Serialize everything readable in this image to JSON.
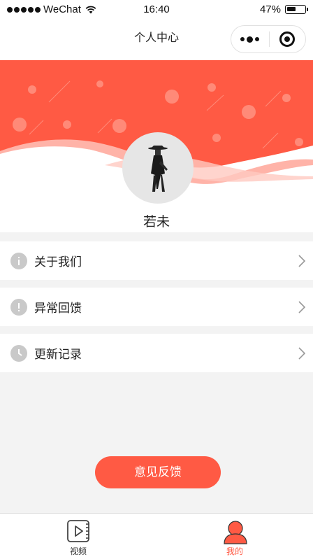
{
  "status_bar": {
    "carrier": "WeChat",
    "time": "16:40",
    "battery": "47%"
  },
  "nav": {
    "title": "个人中心"
  },
  "profile": {
    "name": "若未"
  },
  "menu": [
    {
      "label": "关于我们",
      "icon": "info-icon"
    },
    {
      "label": "异常回馈",
      "icon": "exclamation-icon"
    },
    {
      "label": "更新记录",
      "icon": "clock-icon"
    }
  ],
  "feedback_button": {
    "label": "意见反馈"
  },
  "tabbar": {
    "tabs": [
      {
        "label": "视频",
        "icon": "video-icon",
        "active": false
      },
      {
        "label": "我的",
        "icon": "user-icon",
        "active": true
      }
    ]
  },
  "colors": {
    "accent": "#ff5a44",
    "background": "#f3f3f3",
    "icon_gray": "#c9c9c9"
  }
}
